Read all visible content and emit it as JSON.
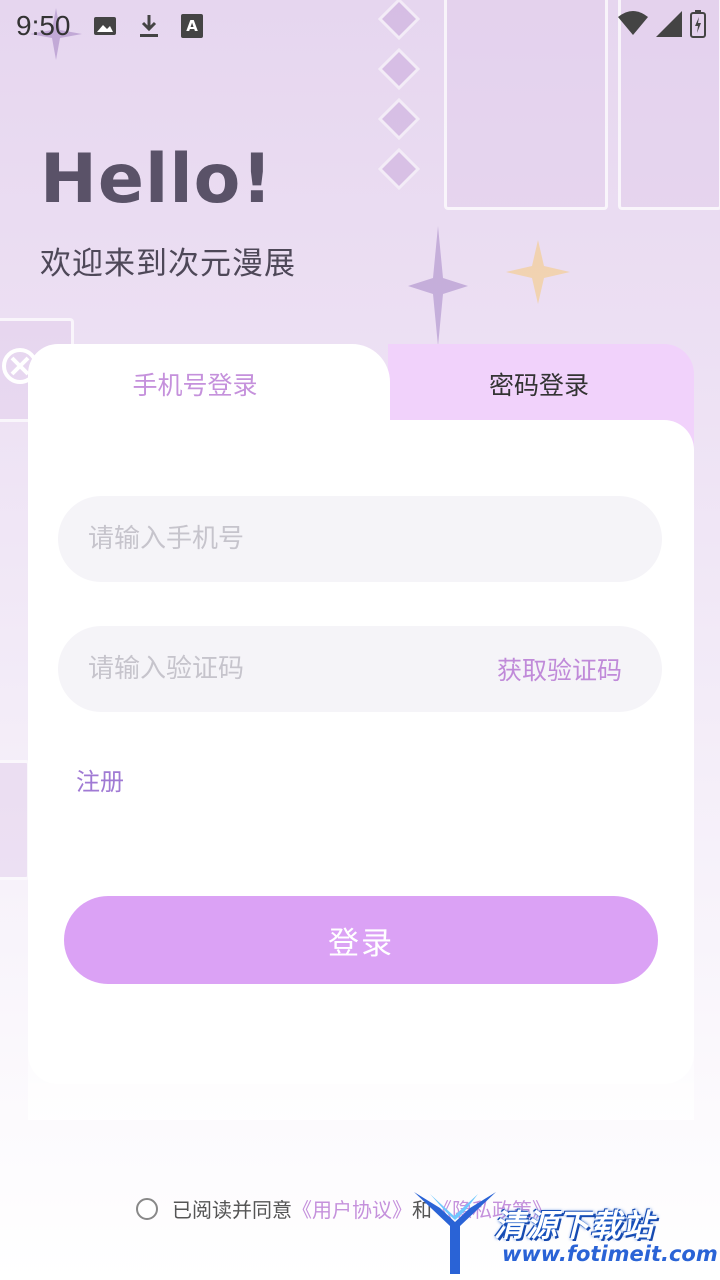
{
  "status_bar": {
    "time": "9:50",
    "left_icons": [
      "image-icon",
      "download-icon",
      "font-icon"
    ],
    "right_icons": [
      "wifi-icon",
      "signal-icon",
      "battery-charging-icon"
    ]
  },
  "hero": {
    "title": "Hello!",
    "subtitle": "欢迎来到次元漫展"
  },
  "login_card": {
    "tabs": [
      {
        "label": "手机号登录",
        "active": true
      },
      {
        "label": "密码登录",
        "active": false
      }
    ],
    "phone_field": {
      "placeholder": "请输入手机号",
      "value": ""
    },
    "code_field": {
      "placeholder": "请输入验证码",
      "value": "",
      "get_code_label": "获取验证码"
    },
    "register_label": "注册",
    "login_button_label": "登录"
  },
  "agreement": {
    "checked": false,
    "prefix": "已阅读并同意",
    "user_agreement": "《用户协议》",
    "conjunction": "和",
    "privacy_policy": "《隐私政策》"
  },
  "watermark": {
    "brand": "清源下载站",
    "url": "www.fotimeit.com"
  },
  "colors": {
    "accent": "#dba2f5",
    "accent_text": "#c591dc",
    "inactive_tab_bg": "#f1d2fb",
    "title": "#5a5268"
  }
}
